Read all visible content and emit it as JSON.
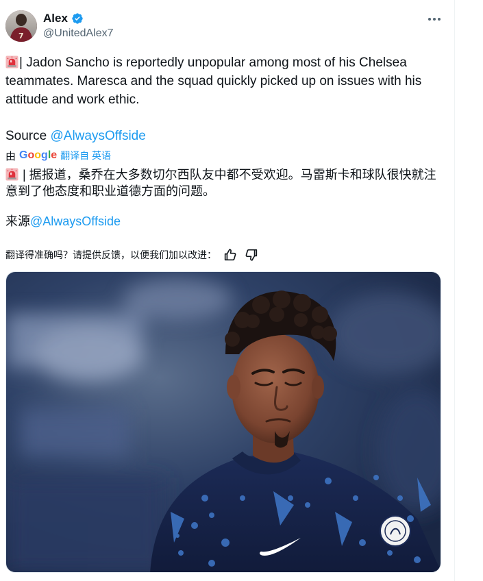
{
  "author": {
    "display_name": "Alex",
    "handle": "@UnitedAlex7",
    "verified": true,
    "avatar_icon": "avatar-photo"
  },
  "tweet": {
    "text_body": "| Jadon Sancho is reportedly unpopular among most of his Chelsea teammates. Maresca and the squad quickly picked up on issues with his attitude and work ethic.",
    "source_label": "Source",
    "source_mention": "@AlwaysOffside",
    "icon": "siren-emoji"
  },
  "translation": {
    "by_label": "由",
    "provider": "Google",
    "from_label": "翻译自 英语",
    "text_body": " | 据报道，桑乔在大多数切尔西队友中都不受欢迎。马雷斯卡和球队很快就注意到了他态度和职业道德方面的问题。",
    "source_label": "来源",
    "source_mention": "@AlwaysOffside",
    "feedback_prompt": "翻译得准确吗？请提供反馈，以便我们加以改进："
  },
  "media": {
    "kind": "photo",
    "icon": "player-photo"
  },
  "colors": {
    "accent": "#1d9bf0",
    "text_primary": "#0f1419",
    "text_secondary": "#536471"
  }
}
